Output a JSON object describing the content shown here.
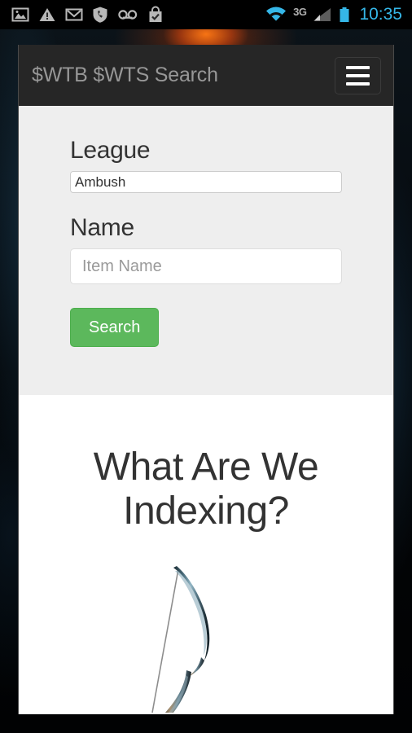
{
  "statusbar": {
    "time": "10:35",
    "network_label": "3G",
    "icons": [
      {
        "name": "image-icon"
      },
      {
        "name": "warning-triangle-icon"
      },
      {
        "name": "gmail-icon"
      },
      {
        "name": "shield-phone-icon"
      },
      {
        "name": "voicemail-icon"
      },
      {
        "name": "play-store-check-icon"
      },
      {
        "name": "wifi-icon"
      },
      {
        "name": "signal-bars-icon"
      },
      {
        "name": "battery-icon"
      }
    ]
  },
  "navbar": {
    "brand": "$WTB $WTS Search",
    "menu_toggle_name": "hamburger-menu-icon"
  },
  "form": {
    "league": {
      "label": "League",
      "value": "Ambush",
      "options": [
        "Ambush"
      ]
    },
    "name": {
      "label": "Name",
      "value": "",
      "placeholder": "Item Name"
    },
    "search_button": "Search"
  },
  "info": {
    "heading": "What Are We Indexing?",
    "image_name": "bow-item-image"
  },
  "colors": {
    "navbar_bg": "#262626",
    "panel_bg": "#eeeeee",
    "accent_green": "#5cb85c",
    "status_blue": "#35b7e8",
    "text_dark": "#333333"
  }
}
